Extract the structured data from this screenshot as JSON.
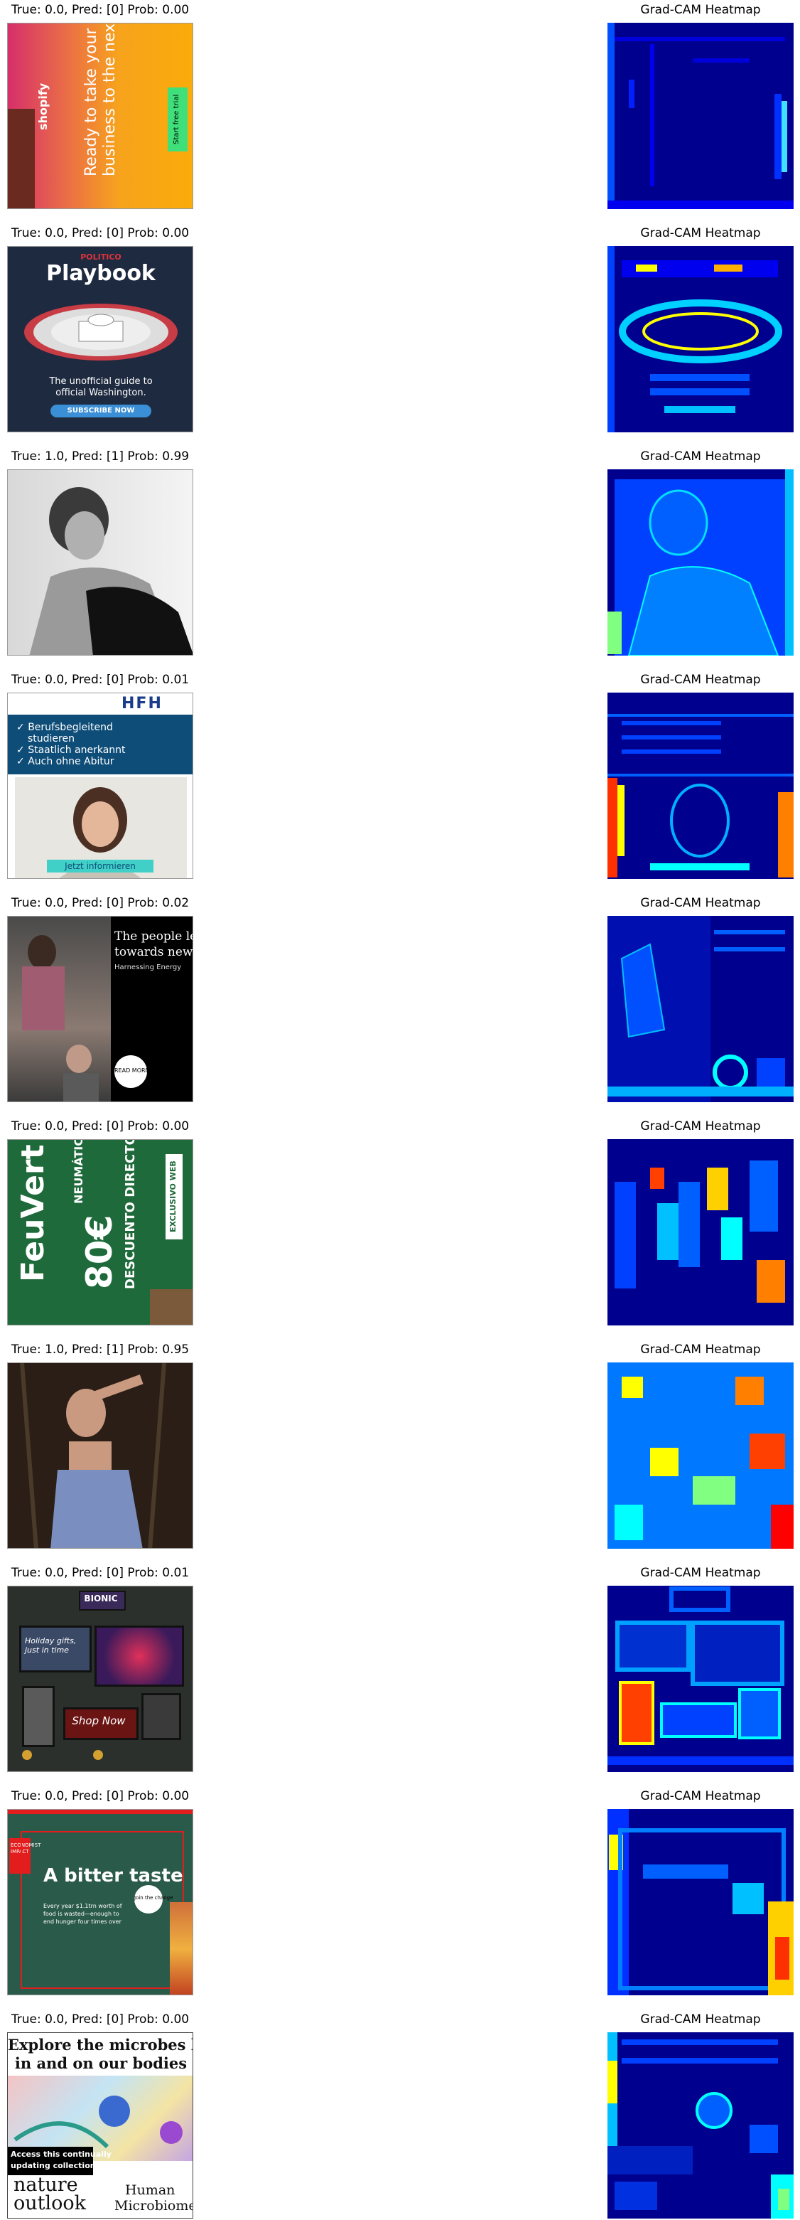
{
  "heatmap_title": "Grad-CAM Heatmap",
  "rows": [
    {
      "caption": "True: 0.0, Pred: [0] Prob: 0.00",
      "texts": {
        "brand": "shopify",
        "headline1": "Ready to take your",
        "headline2": "business to the next level?",
        "cta": "Start free trial"
      }
    },
    {
      "caption": "True: 0.0, Pred: [0] Prob: 0.00",
      "texts": {
        "publisher": "POLITICO",
        "title": "Playbook",
        "line1": "The unofficial guide to",
        "line2": "official Washington.",
        "cta": "SUBSCRIBE NOW"
      }
    },
    {
      "caption": "True: 1.0, Pred: [1] Prob: 0.99",
      "texts": {}
    },
    {
      "caption": "True: 0.0, Pred: [0] Prob: 0.01",
      "texts": {
        "logo": "HFH",
        "b1": "Berufsbegleitend",
        "b1b": "studieren",
        "b2": "Staatlich anerkannt",
        "b3": "Auch ohne Abitur",
        "cta": "Jetzt informieren"
      }
    },
    {
      "caption": "True: 0.0, Pred: [0] Prob: 0.02",
      "texts": {
        "h1": "The people leading the surge",
        "h2": "towards new energy",
        "sub": "Harnessing Energy",
        "cta": "READ MORE"
      }
    },
    {
      "caption": "True: 0.0, Pred: [0] Prob: 0.00",
      "texts": {
        "brand": "FeuVert",
        "promo": "NEUMÁTICOS",
        "price": "80€",
        "label": "DESCUENTO DIRECTO",
        "tag": "EXCLUSIVO WEB"
      }
    },
    {
      "caption": "True: 1.0, Pred: [1] Prob: 0.95",
      "texts": {}
    },
    {
      "caption": "True: 0.0, Pred: [0] Prob: 0.01",
      "texts": {
        "brand": "BIONIC",
        "gifts": "Holiday gifts, just in time",
        "cta": "Shop Now"
      }
    },
    {
      "caption": "True: 0.0, Pred: [0] Prob: 0.00",
      "texts": {
        "badge": "ECONOMIST IMPACT",
        "headline": "A bitter taste",
        "sub": "Every year $1.1trn worth of food is wasted—enough to end hunger four times over",
        "cta": "Join the change"
      }
    },
    {
      "caption": "True: 0.0, Pred: [0] Prob: 0.00",
      "texts": {
        "h1": "Explore the microbes living",
        "h2": "in and on our bodies",
        "access1": "Access this continually",
        "access2": "updating collection »",
        "brand1": "nature",
        "brand2": "outlook",
        "topic1": "Human",
        "topic2": "Microbiome"
      }
    }
  ],
  "colors": {
    "jet_dark": "#00008f",
    "jet_blue": "#0000ff",
    "jet_cyan": "#00ffff",
    "jet_yellow": "#ffff00",
    "jet_red": "#ff0000"
  }
}
